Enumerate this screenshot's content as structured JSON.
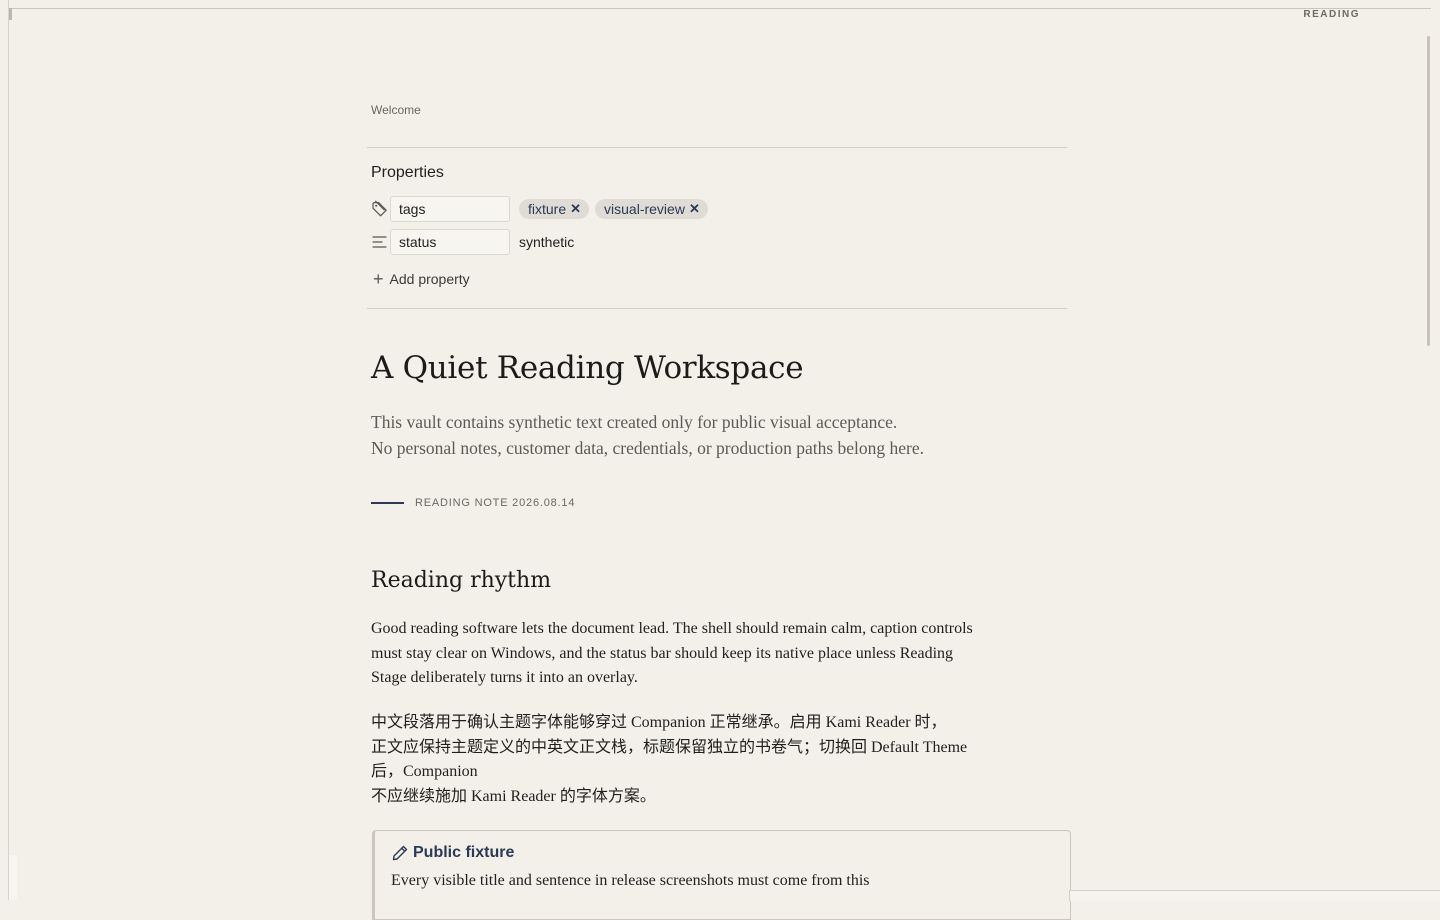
{
  "view_mode": "READING",
  "breadcrumb": "Welcome",
  "properties": {
    "title": "Properties",
    "rows": [
      {
        "icon": "tag-icon",
        "key": "tags",
        "tags": [
          "fixture",
          "visual-review"
        ]
      },
      {
        "icon": "text-lines-icon",
        "key": "status",
        "value": "synthetic"
      }
    ],
    "add_label": "Add property"
  },
  "document": {
    "title": "A Quiet Reading Workspace",
    "lead": [
      "This vault contains synthetic text created only for public visual acceptance.",
      "No personal notes, customer data, credentials, or production paths belong here."
    ],
    "note_meta": "READING NOTE 2026.08.14",
    "section_heading": "Reading rhythm",
    "paragraph_1": "Good reading software lets the document lead. The shell should remain calm, caption controls must stay clear on Windows, and the status bar should keep its native place unless Reading Stage deliberately turns it into an overlay.",
    "paragraph_2_lines": [
      "中文段落用于确认主题字体能够穿过 Companion 正常继承。启用 Kami Reader 时，",
      "正文应保持主题定义的中英文正文栈，标题保留独立的书卷气；切换回 Default Theme",
      "后，Companion",
      "不应继续施加 Kami Reader 的字体方案。"
    ],
    "callout": {
      "icon": "pencil-icon",
      "title": "Public fixture",
      "body": "Every visible title and sentence in release screenshots must come from this"
    }
  },
  "colors": {
    "background": "#f3f0e9",
    "accent": "#2b3a55",
    "muted_text": "#5d5a55"
  }
}
